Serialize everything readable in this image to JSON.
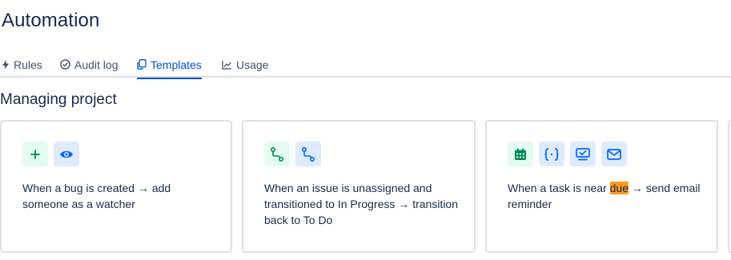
{
  "page": {
    "title": "Automation"
  },
  "tabs": [
    {
      "label": "Rules",
      "icon": "lightning-icon",
      "active": false
    },
    {
      "label": "Audit log",
      "icon": "check-circle-icon",
      "active": false
    },
    {
      "label": "Templates",
      "icon": "copy-icon",
      "active": true
    },
    {
      "label": "Usage",
      "icon": "line-chart-icon",
      "active": false
    }
  ],
  "section": {
    "title": "Managing project"
  },
  "cards": [
    {
      "icons": [
        "plus-icon",
        "eye-icon"
      ],
      "text": "When a bug is created → add someone as a watcher"
    },
    {
      "icons": [
        "branch-icon",
        "branch-icon"
      ],
      "text": "When an issue is unassigned and transitioned to In Progress → transition back to To Do"
    },
    {
      "icons": [
        "calendar-icon",
        "braces-icon",
        "monitor-check-icon",
        "mail-icon"
      ],
      "text_before": "When a task is near ",
      "text_highlight": "due",
      "text_after": " → send email reminder"
    }
  ],
  "colors": {
    "accent": "#0052cc",
    "green_icon": "#00875a",
    "green_bg": "#e3fcef",
    "blue_icon": "#0065ff",
    "blue_bg": "#deebff",
    "highlight": "#ff991f",
    "border": "#dfe1e6"
  }
}
